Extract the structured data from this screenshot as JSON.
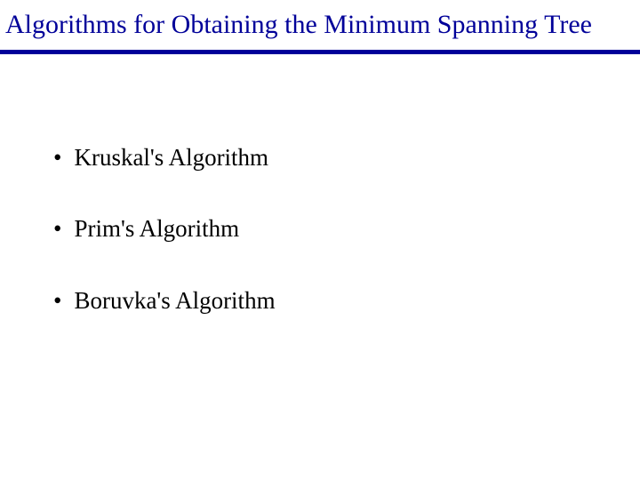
{
  "title": "Algorithms for Obtaining the Minimum Spanning Tree",
  "bullets": {
    "item0": "Kruskal's Algorithm",
    "item1": "Prim's Algorithm",
    "item2": "Boruvka's Algorithm"
  },
  "bullet_char": "•"
}
